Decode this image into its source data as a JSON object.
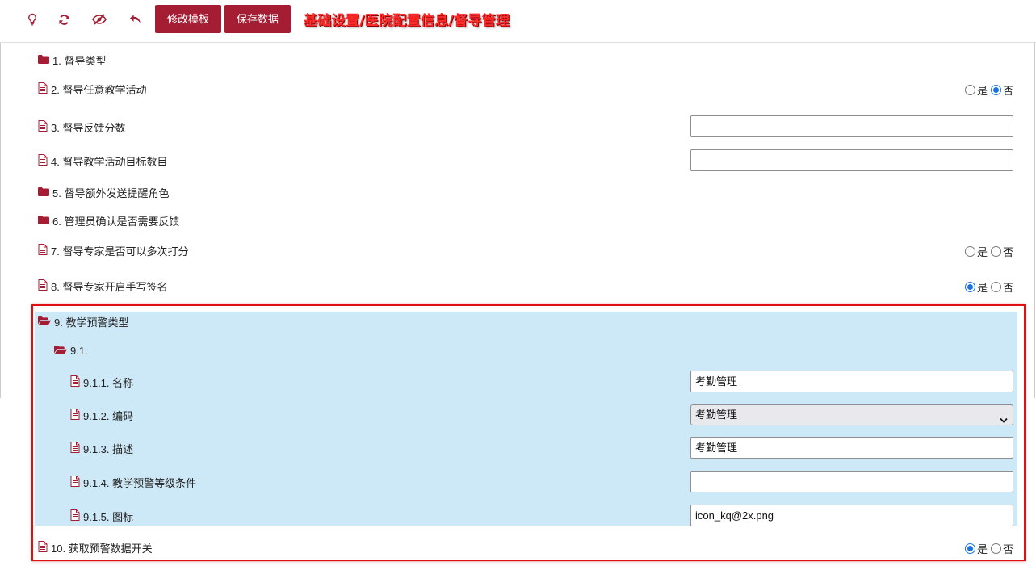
{
  "toolbar": {
    "icons": [
      "lightbulb-icon",
      "refresh-icon",
      "eye-slash-icon",
      "undo-icon"
    ],
    "edit_template_label": "修改模板",
    "save_data_label": "保存数据",
    "breadcrumb": "基础设置/医院配置信息/督导管理"
  },
  "items": [
    {
      "label": "1. 督导类型",
      "type": "folder"
    },
    {
      "label": "2. 督导任意教学活动",
      "type": "radio",
      "yes": "是",
      "no": "否",
      "selected": "no"
    },
    {
      "label": "3. 督导反馈分数",
      "type": "input",
      "value": ""
    },
    {
      "label": "4. 督导教学活动目标数目",
      "type": "input",
      "value": ""
    },
    {
      "label": "5. 督导额外发送提醒角色",
      "type": "folder"
    },
    {
      "label": "6. 管理员确认是否需要反馈",
      "type": "folder"
    },
    {
      "label": "7. 督导专家是否可以多次打分",
      "type": "radio",
      "yes": "是",
      "no": "否",
      "selected": "none"
    },
    {
      "label": "8. 督导专家开启手写签名",
      "type": "radio",
      "yes": "是",
      "no": "否",
      "selected": "yes"
    },
    {
      "label": "9. 教学预警类型",
      "type": "folder-open"
    },
    {
      "label": "9.1.",
      "type": "folder-open"
    },
    {
      "label": "9.1.1. 名称",
      "type": "input",
      "value": "考勤管理"
    },
    {
      "label": "9.1.2. 编码",
      "type": "select",
      "value": "考勤管理"
    },
    {
      "label": "9.1.3. 描述",
      "type": "input",
      "value": "考勤管理"
    },
    {
      "label": "9.1.4. 教学预警等级条件",
      "type": "input",
      "value": ""
    },
    {
      "label": "9.1.5. 图标",
      "type": "input",
      "value": "icon_kq@2x.png"
    },
    {
      "label": "10. 获取预警数据开关",
      "type": "radio",
      "yes": "是",
      "no": "否",
      "selected": "yes"
    }
  ],
  "colors": {
    "accent": "#a51d33",
    "highlight": "#cde8f6",
    "frame": "#e01010",
    "radio": "#1b72d9",
    "breadcrumb": "#ff2a2a"
  }
}
